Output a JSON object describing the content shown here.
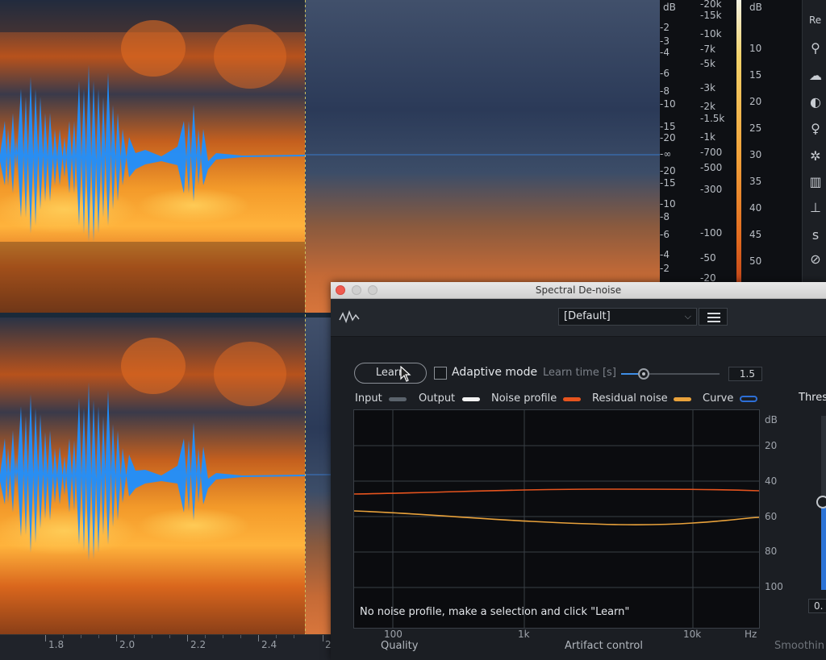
{
  "timeline": {
    "ticks": [
      "1.8",
      "2.0",
      "2.2",
      "2.4",
      "2"
    ]
  },
  "freq_scale": [
    "dB",
    "-20k",
    "-15k",
    "-2",
    "-10k",
    "-3",
    "-7k",
    "-4",
    "-5k",
    "-6",
    "-3k",
    "-8",
    "-2k",
    "-10",
    "-1.5k",
    "-1k",
    "-15",
    "-700",
    "-20",
    "-500",
    "-∞",
    "-20",
    "-15",
    "-300",
    "-10",
    "-8",
    "-6",
    "-100",
    "-4",
    "-50",
    "-2",
    "-20"
  ],
  "meter_scale": [
    "dB",
    "10",
    "15",
    "20",
    "25",
    "30",
    "35",
    "40",
    "45",
    "50"
  ],
  "icon_panel": {
    "tab_label": "Re"
  },
  "plugin": {
    "title": "Spectral De-noise",
    "preset": "[Default]",
    "learn_label": "Learn",
    "adaptive_label": "Adaptive mode",
    "learn_time_label": "Learn time [s]",
    "learn_time_value": "1.5",
    "learn_time_fraction": 0.23,
    "legend": [
      {
        "label": "Input",
        "color": "#5b636c"
      },
      {
        "label": "Output",
        "color": "#f2f2f2"
      },
      {
        "label": "Noise profile",
        "color": "#e6541e"
      },
      {
        "label": "Residual noise",
        "color": "#e9a23b"
      },
      {
        "label": "Curve",
        "color": "#2d6fd6"
      }
    ],
    "graph": {
      "y_unit": "dB",
      "y_ticks": [
        "20",
        "40",
        "60",
        "80",
        "100"
      ],
      "x_ticks": [
        "100",
        "1k",
        "10k",
        "Hz"
      ],
      "message": "No noise profile, make a selection and click \"Learn\""
    },
    "threshold_label": "Thres",
    "threshold_value": "0.",
    "quality_label": "Quality",
    "artifact_label": "Artifact control",
    "smoothing_label": "Smoothin"
  }
}
